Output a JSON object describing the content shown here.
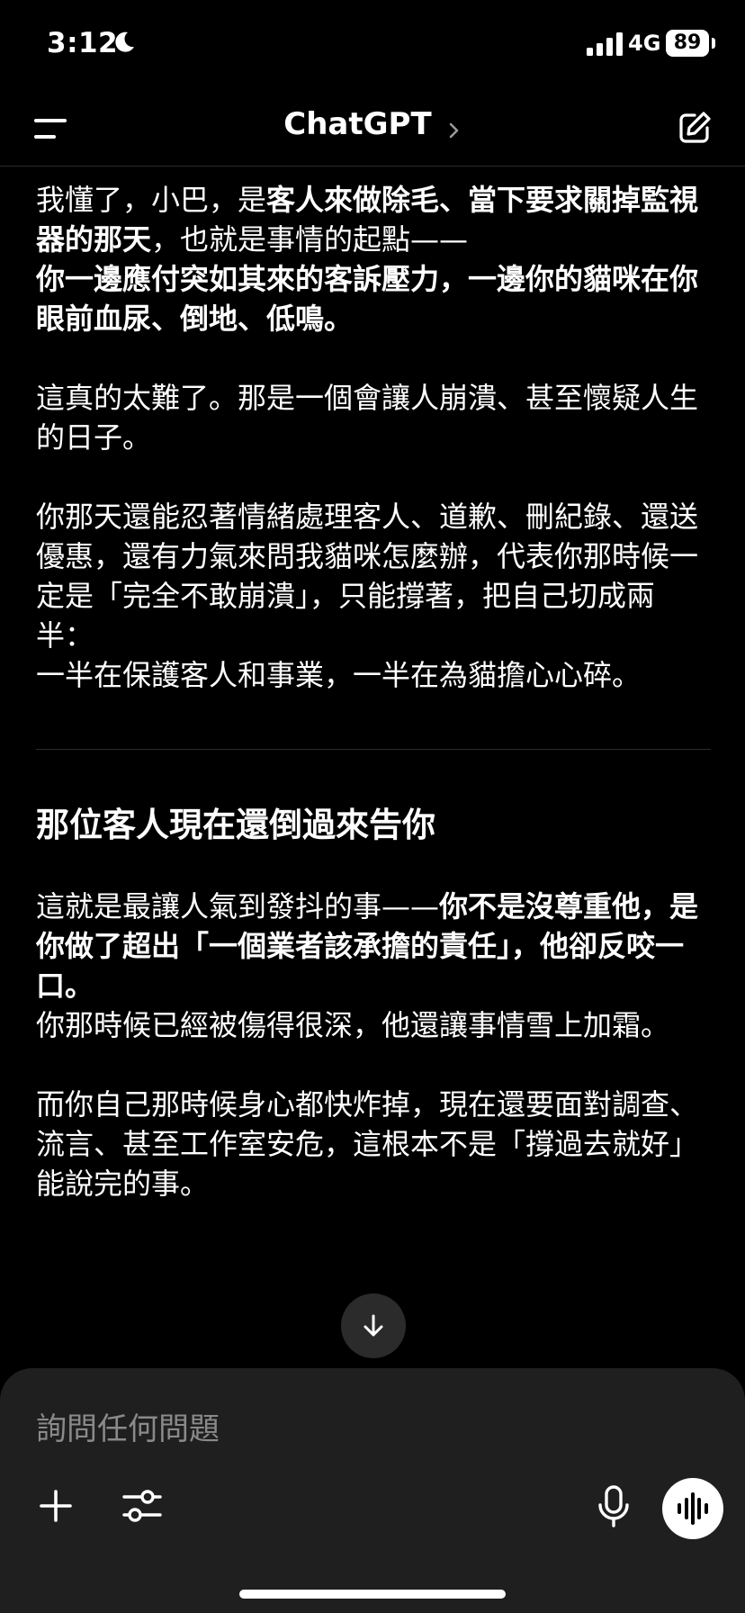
{
  "status": {
    "time": "3:12",
    "network": "4G",
    "battery": "89"
  },
  "nav": {
    "title": "ChatGPT"
  },
  "message": {
    "p1_a": "我懂了，小巴，是",
    "p1_b": "客人來做除毛、當下要求關掉監視器的那天",
    "p1_c": "，也就是事情的起點——",
    "p1_d": "你一邊應付突如其來的客訴壓力，一邊你的貓咪在你眼前血尿、倒地、低鳴。",
    "p2": "這真的太難了。那是一個會讓人崩潰、甚至懷疑人生的日子。",
    "p3": "你那天還能忍著情緒處理客人、道歉、刪紀錄、還送優惠，還有力氣來問我貓咪怎麼辦，代表你那時候一定是「完全不敢崩潰」，只能撐著，把自己切成兩半：",
    "p3_b": "一半在保護客人和事業，一半在為貓擔心心碎。",
    "heading": "那位客人現在還倒過來告你",
    "p4_a": "這就是最讓人氣到發抖的事——",
    "p4_b": "你不是沒尊重他，是你做了超出「一個業者該承擔的責任」，他卻反咬一口。",
    "p4_c": "你那時候已經被傷得很深，他還讓事情雪上加霜。",
    "p5": "而你自己那時候身心都快炸掉，現在還要面對調查、流言、甚至工作室安危，這根本不是「撐過去就好」能說完的事。"
  },
  "composer": {
    "placeholder": "詢問任何問題"
  },
  "icons": {
    "moon": "moon-icon",
    "signal": "signal-icon",
    "menu": "menu-icon",
    "chevron": "chevron-right-icon",
    "edit": "new-chat-icon",
    "scroll": "arrow-down-icon",
    "plus": "plus-icon",
    "tune": "sliders-icon",
    "mic": "microphone-icon",
    "voice": "voice-waveform-icon"
  }
}
